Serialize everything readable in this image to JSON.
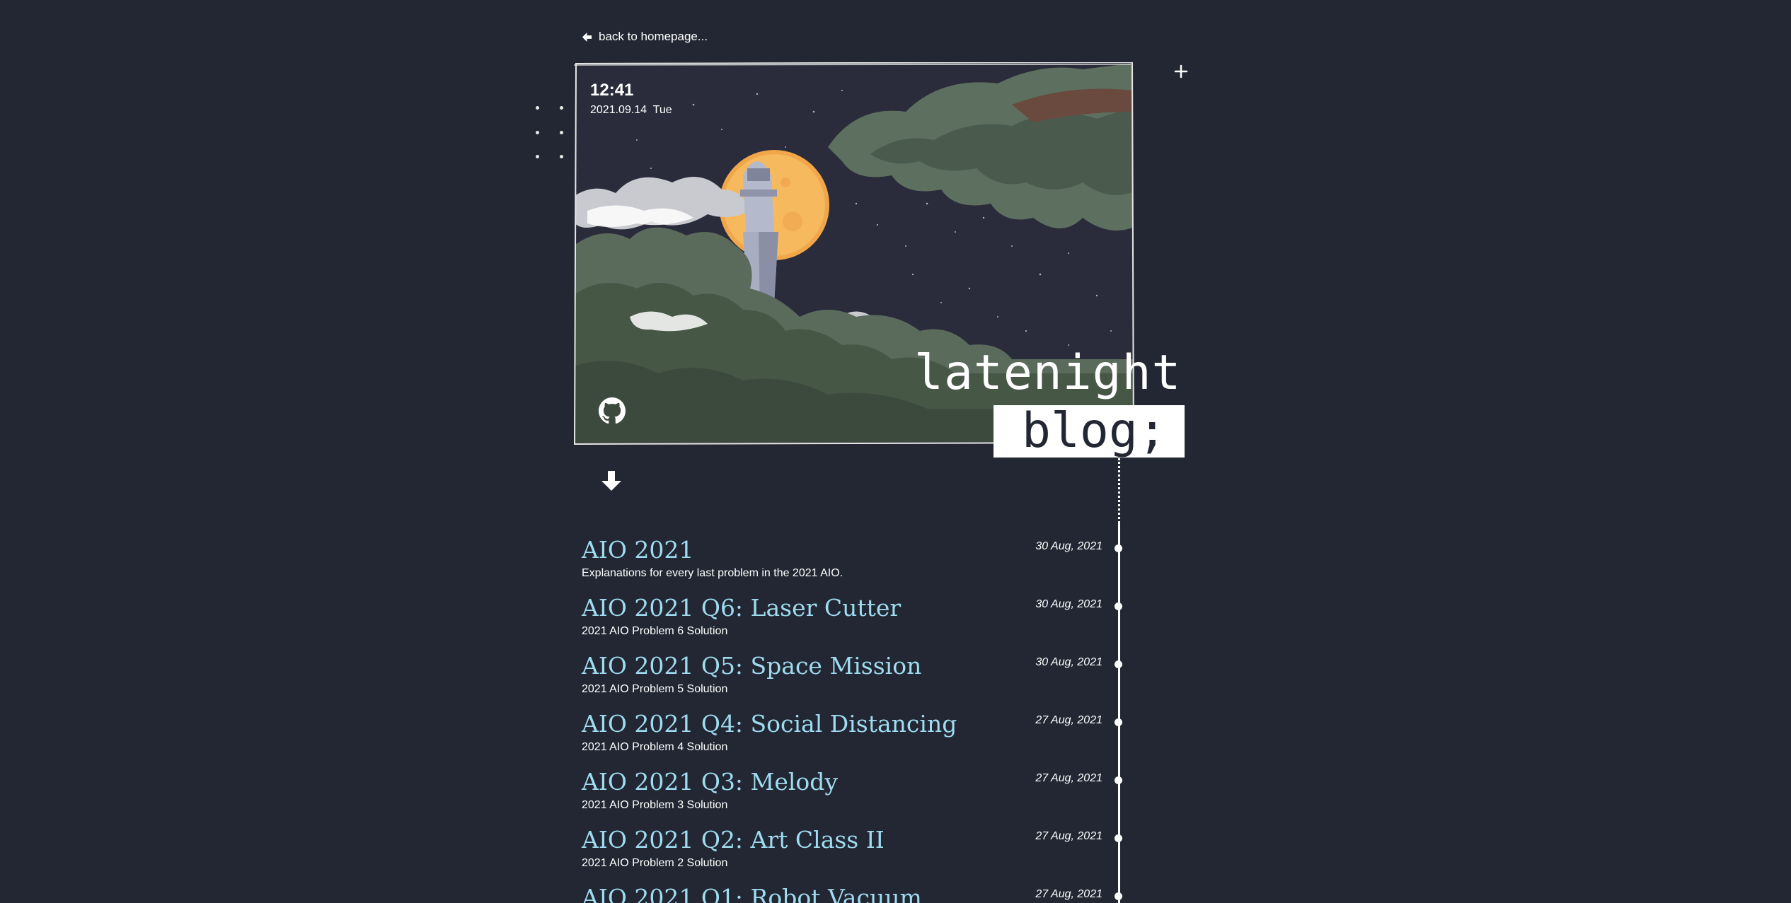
{
  "nav": {
    "back_label": "back to homepage..."
  },
  "hero": {
    "time": "12:41",
    "date": "2021.09.14  Tue",
    "title_line1": "latenight",
    "title_line2": "blog;"
  },
  "icons": {
    "back": "arrow-left-icon",
    "plus": "plus-icon",
    "github": "github-icon",
    "scroll": "arrow-down-icon"
  },
  "colors": {
    "background": "#222733",
    "post_title": "#9fdcf0",
    "text": "#ffffff"
  },
  "posts": [
    {
      "title": "AIO 2021",
      "description": "Explanations for every last problem in the 2021 AIO.",
      "date": "30 Aug, 2021"
    },
    {
      "title": "AIO 2021 Q6: Laser Cutter",
      "description": "2021 AIO Problem 6 Solution",
      "date": "30 Aug, 2021"
    },
    {
      "title": "AIO 2021 Q5: Space Mission",
      "description": "2021 AIO Problem 5 Solution",
      "date": "30 Aug, 2021"
    },
    {
      "title": "AIO 2021 Q4: Social Distancing",
      "description": "2021 AIO Problem 4 Solution",
      "date": "27 Aug, 2021"
    },
    {
      "title": "AIO 2021 Q3: Melody",
      "description": "2021 AIO Problem 3 Solution",
      "date": "27 Aug, 2021"
    },
    {
      "title": "AIO 2021 Q2: Art Class II",
      "description": "2021 AIO Problem 2 Solution",
      "date": "27 Aug, 2021"
    },
    {
      "title": "AIO 2021 Q1: Robot Vacuum",
      "description": "",
      "date": "27 Aug, 2021"
    }
  ]
}
